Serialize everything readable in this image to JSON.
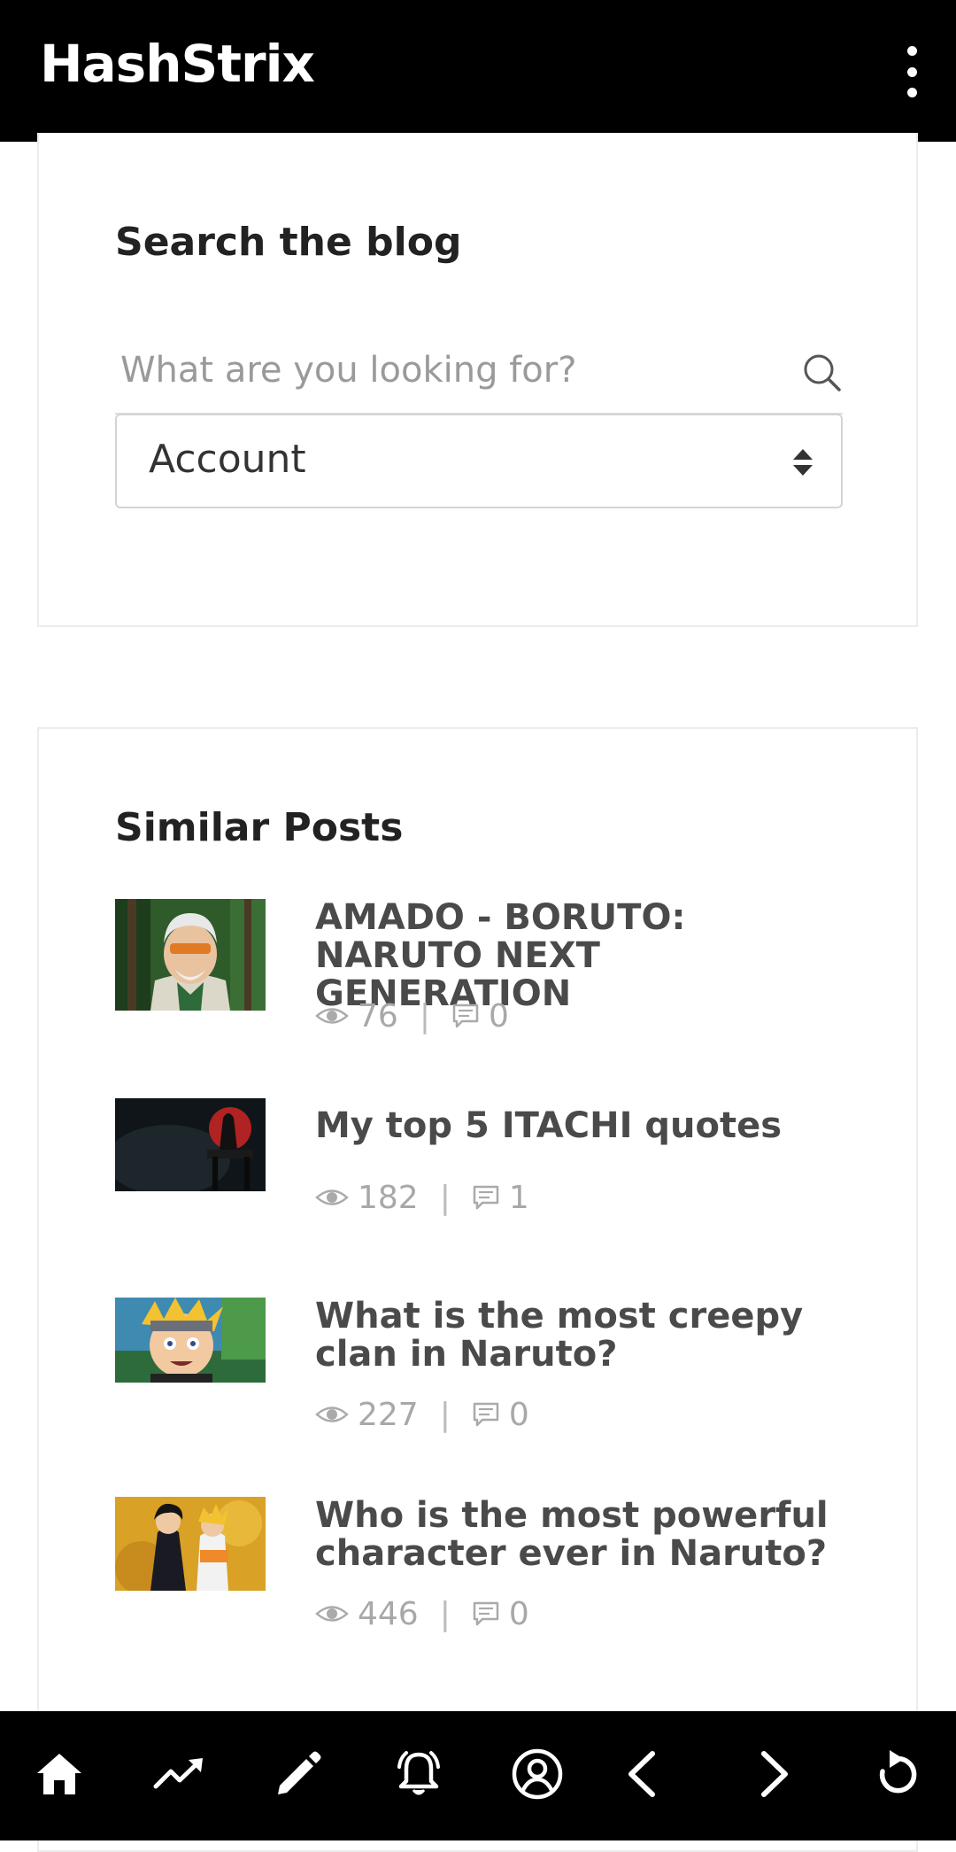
{
  "app": {
    "title": "HashStrix",
    "menu_icon": "more-vertical-icon"
  },
  "search_card": {
    "title": "Search the blog",
    "search": {
      "value": "",
      "placeholder": "What are you looking for?",
      "icon": "search-icon"
    },
    "category_select": {
      "selected": "Account",
      "icon": "sort-arrows-icon"
    }
  },
  "similar_posts": {
    "title": "Similar Posts",
    "items": [
      {
        "title": "AMADO - BORUTO: NARUTO NEXT GENERATION",
        "views": "76",
        "comments": "0",
        "thumbnail": "amado-thumbnail"
      },
      {
        "title": "My top 5 ITACHI quotes",
        "views": "182",
        "comments": "1",
        "thumbnail": "itachi-thumbnail"
      },
      {
        "title": "What is the most creepy clan in Naruto?",
        "views": "227",
        "comments": "0",
        "thumbnail": "naruto-thumbnail"
      },
      {
        "title": "Who is the most powerful character ever in Naruto?",
        "views": "446",
        "comments": "0",
        "thumbnail": "sasuke-naruto-thumbnail"
      }
    ],
    "separator": "|"
  },
  "bottom_nav": [
    {
      "icon": "home-icon"
    },
    {
      "icon": "trending-icon"
    },
    {
      "icon": "edit-icon"
    },
    {
      "icon": "notifications-icon"
    },
    {
      "icon": "account-icon"
    },
    {
      "icon": "back-icon"
    },
    {
      "icon": "forward-icon"
    },
    {
      "icon": "refresh-icon"
    }
  ]
}
